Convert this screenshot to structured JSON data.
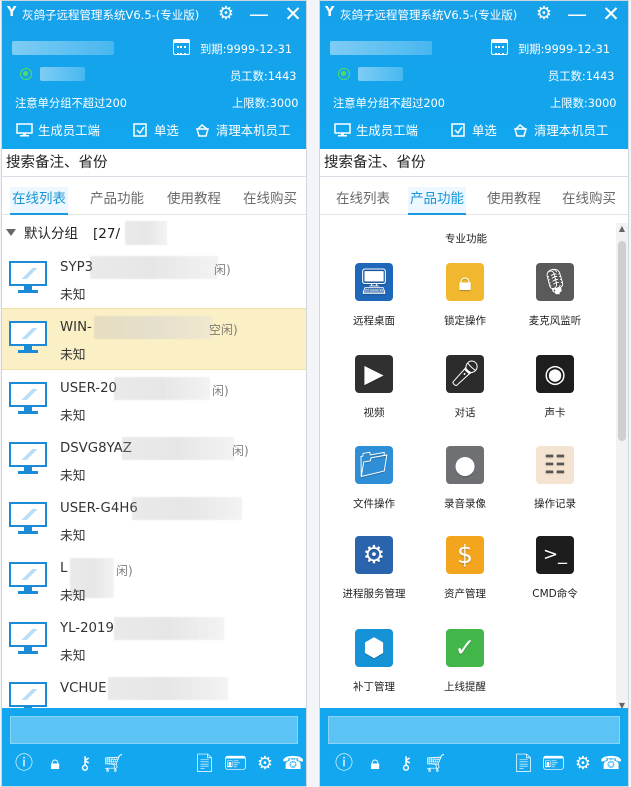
{
  "app": {
    "title": "灰鸽子远程管理系统V6.5-(专业版)",
    "expire": "到期:9999-12-31",
    "employee_count": "员工数:1443",
    "group_limit_note": "注意单分组不超过200",
    "upper_limit": "上限数:3000",
    "actions": [
      "生成员工端",
      "单选",
      "清理本机员工"
    ],
    "search_placeholder": "搜索备注、省份",
    "tabs": [
      "在线列表",
      "产品功能",
      "使用教程",
      "在线购买"
    ]
  },
  "left": {
    "group_label": "默认分组",
    "group_count": "[27/",
    "devices": [
      {
        "name": "SYP3",
        "status": "未知",
        "tail": "闲)"
      },
      {
        "name": "WIN-",
        "status": "未知",
        "tail": "空闲)",
        "selected": true
      },
      {
        "name": "USER-20",
        "status": "未知",
        "tail": "闲)"
      },
      {
        "name": "DSVG8YAZ",
        "status": "未知",
        "tail": "闲)"
      },
      {
        "name": "USER-G4H6",
        "status": "未知",
        "tail": ""
      },
      {
        "name": "L",
        "status": "未知",
        "tail": "闲)"
      },
      {
        "name": "YL-2019",
        "status": "未知",
        "tail": ""
      },
      {
        "name": "VCHUE",
        "status": "",
        "tail": ""
      }
    ]
  },
  "right": {
    "section_title": "专业功能",
    "features": [
      {
        "label": "远程桌面",
        "icon": "remote-desktop-icon",
        "color": "#1f67b8"
      },
      {
        "label": "锁定操作",
        "icon": "lock-icon",
        "color": "#f0b72f"
      },
      {
        "label": "麦克风监听",
        "icon": "microphone-icon",
        "color": "#5a5a5a"
      },
      {
        "label": "视频",
        "icon": "video-camera-icon",
        "color": "#303030"
      },
      {
        "label": "对话",
        "icon": "dialog-microphones-icon",
        "color": "#2c2c2c"
      },
      {
        "label": "声卡",
        "icon": "sound-card-icon",
        "color": "#1e1e1e"
      },
      {
        "label": "文件操作",
        "icon": "folder-icon",
        "color": "#2e8ed6"
      },
      {
        "label": "录音录像",
        "icon": "recording-icon",
        "color": "#6e7074"
      },
      {
        "label": "操作记录",
        "icon": "operation-log-icon",
        "color": "#f4e3d0"
      },
      {
        "label": "进程服务管理",
        "icon": "process-service-icon",
        "color": "#2a64ad"
      },
      {
        "label": "资产管理",
        "icon": "money-bag-icon",
        "color": "#f3a61d"
      },
      {
        "label": "CMD命令",
        "icon": "cmd-terminal-icon",
        "color": "#1d1d1d"
      },
      {
        "label": "补丁管理",
        "icon": "patch-box-icon",
        "color": "#1593d6"
      },
      {
        "label": "上线提醒",
        "icon": "online-alert-icon",
        "color": "#42b649"
      }
    ]
  },
  "colors": {
    "header_blue": "#12a7ef",
    "accent_blue": "#1695d7",
    "selected_bg": "#fbefc6"
  }
}
